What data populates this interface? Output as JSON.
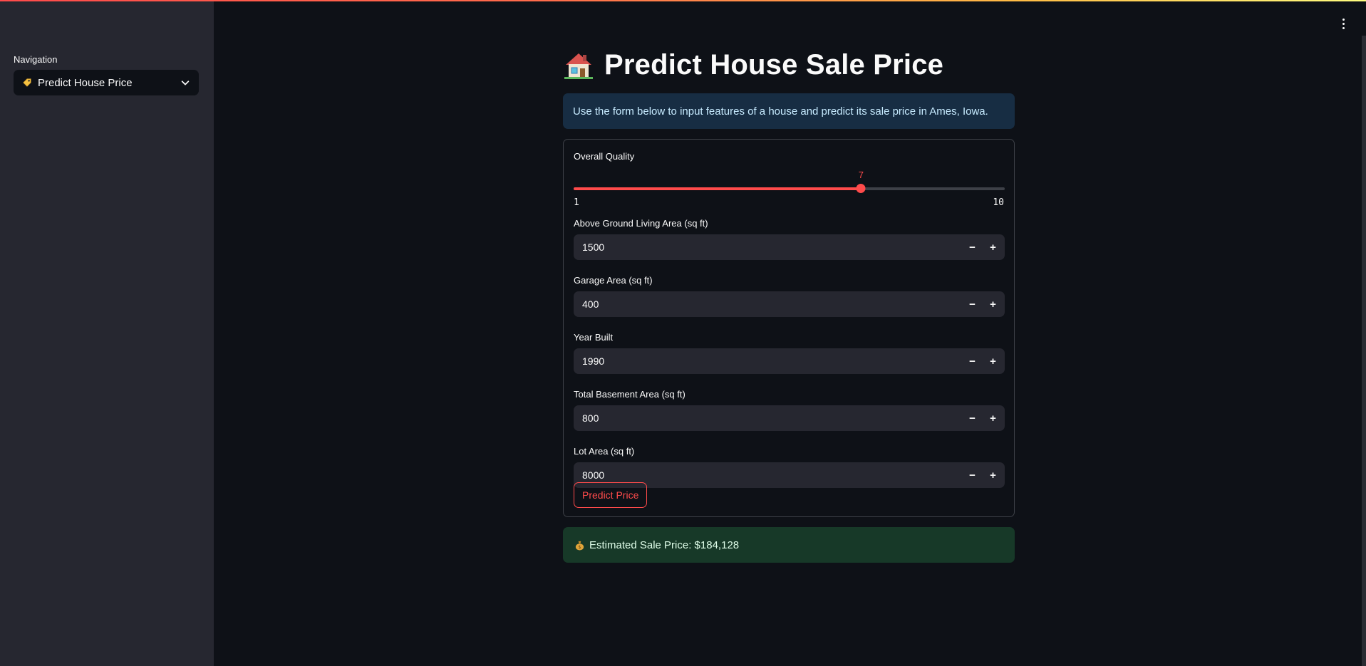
{
  "sidebar": {
    "nav_label": "Navigation",
    "nav_select": {
      "icon": "label-tag-icon",
      "value": "Predict House Price"
    }
  },
  "header": {
    "menu_icon": "kebab-menu-icon"
  },
  "main": {
    "title_icon": "house-icon",
    "title": "Predict House Sale Price",
    "info": "Use the form below to input features of a house and predict its sale price in Ames, Iowa.",
    "form": {
      "slider": {
        "label": "Overall Quality",
        "value": "7",
        "min": "1",
        "max": "10"
      },
      "fields": [
        {
          "label": "Above Ground Living Area (sq ft)",
          "value": "1500"
        },
        {
          "label": "Garage Area (sq ft)",
          "value": "400"
        },
        {
          "label": "Year Built",
          "value": "1990"
        },
        {
          "label": "Total Basement Area (sq ft)",
          "value": "800"
        },
        {
          "label": "Lot Area (sq ft)",
          "value": "8000"
        }
      ],
      "step_minus": "−",
      "step_plus": "+",
      "submit_label": "Predict Price"
    },
    "result": {
      "icon": "money-bag-icon",
      "text": "Estimated Sale Price: $184,128"
    }
  },
  "colors": {
    "accent": "#ff4b4b",
    "background": "#0e1117",
    "sidebar": "#262730",
    "info_bg": "#172d43",
    "success_bg": "#173928"
  }
}
